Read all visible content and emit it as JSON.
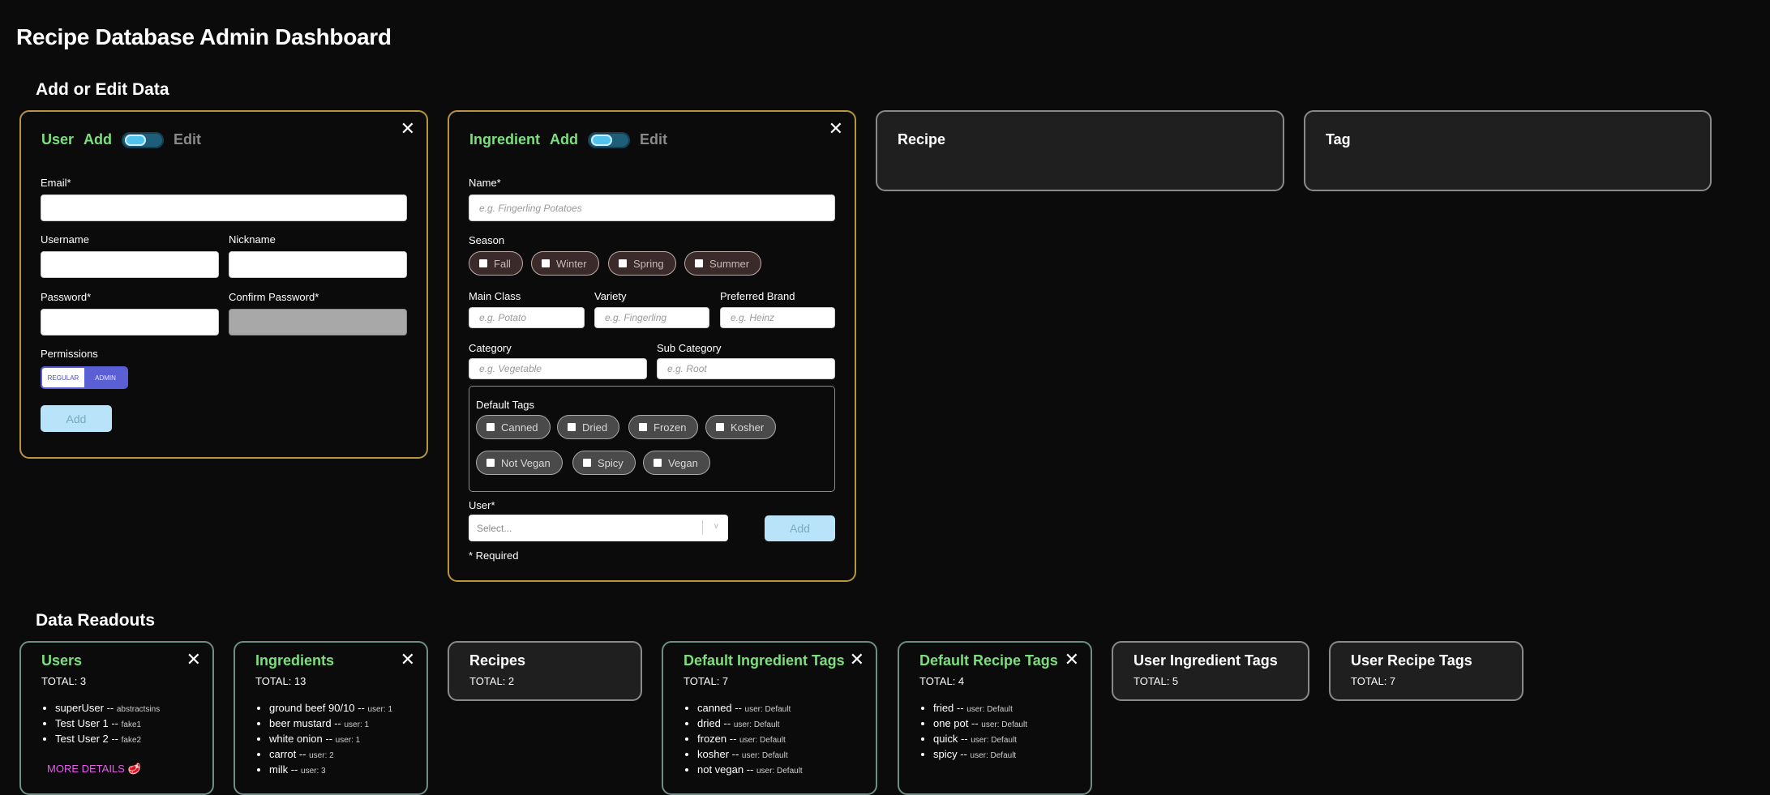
{
  "page": {
    "title": "Recipe Database Admin Dashboard"
  },
  "sections": {
    "edit": "Add or Edit Data",
    "readouts": "Data Readouts"
  },
  "colors": {
    "accent_green": "#7be07b",
    "gold_border": "#b8953a",
    "add_button": "#b9e3f9",
    "permission_toggle": "#5b5fd6"
  },
  "user_form": {
    "title": "User",
    "mode_add": "Add",
    "mode_edit": "Edit",
    "close": "✕",
    "email_label": "Email*",
    "username_label": "Username",
    "nickname_label": "Nickname",
    "password_label": "Password*",
    "confirm_password_label": "Confirm Password*",
    "permissions_label": "Permissions",
    "perm_regular": "REGULAR",
    "perm_admin": "ADMIN",
    "add_button": "Add"
  },
  "ingredient_form": {
    "title": "Ingredient",
    "mode_add": "Add",
    "mode_edit": "Edit",
    "close": "✕",
    "name_label": "Name*",
    "name_placeholder": "e.g. Fingerling Potatoes",
    "season_label": "Season",
    "seasons": [
      "Fall",
      "Winter",
      "Spring",
      "Summer"
    ],
    "main_class_label": "Main Class",
    "main_class_placeholder": "e.g. Potato",
    "variety_label": "Variety",
    "variety_placeholder": "e.g. Fingerling",
    "brand_label": "Preferred Brand",
    "brand_placeholder": "e.g. Heinz",
    "category_label": "Category",
    "category_placeholder": "e.g. Vegetable",
    "subcategory_label": "Sub Category",
    "subcategory_placeholder": "e.g. Root",
    "default_tags_label": "Default Tags",
    "tags": [
      "Canned",
      "Dried",
      "Frozen",
      "Kosher",
      "Not Vegan",
      "Spicy",
      "Vegan"
    ],
    "user_label": "User*",
    "user_select_placeholder": "Select...",
    "add_button": "Add",
    "required_note": "* Required"
  },
  "recipe_form": {
    "title": "Recipe"
  },
  "tag_form": {
    "title": "Tag"
  },
  "readouts": {
    "users": {
      "title": "Users",
      "total": "TOTAL: 3",
      "close": "✕",
      "items": [
        {
          "name": "superUser --",
          "meta": "abstractsins"
        },
        {
          "name": "Test User 1 --",
          "meta": "fake1"
        },
        {
          "name": "Test User 2 --",
          "meta": "fake2"
        }
      ],
      "more": "MORE DETAILS 🥩"
    },
    "ingredients": {
      "title": "Ingredients",
      "total": "TOTAL: 13",
      "close": "✕",
      "items": [
        {
          "name": "ground beef 90/10 --",
          "meta": "user: 1"
        },
        {
          "name": "beer mustard --",
          "meta": "user: 1"
        },
        {
          "name": "white onion --",
          "meta": "user: 1"
        },
        {
          "name": "carrot --",
          "meta": "user: 2"
        },
        {
          "name": "milk --",
          "meta": "user: 3"
        }
      ]
    },
    "recipes": {
      "title": "Recipes",
      "total": "TOTAL: 2"
    },
    "default_ingredient_tags": {
      "title": "Default Ingredient Tags",
      "total": "TOTAL: 7",
      "close": "✕",
      "items": [
        {
          "name": "canned --",
          "meta": "user: Default"
        },
        {
          "name": "dried --",
          "meta": "user: Default"
        },
        {
          "name": "frozen --",
          "meta": "user: Default"
        },
        {
          "name": "kosher --",
          "meta": "user: Default"
        },
        {
          "name": "not vegan --",
          "meta": "user: Default"
        }
      ]
    },
    "default_recipe_tags": {
      "title": "Default Recipe Tags",
      "total": "TOTAL: 4",
      "close": "✕",
      "items": [
        {
          "name": "fried --",
          "meta": "user: Default"
        },
        {
          "name": "one pot --",
          "meta": "user: Default"
        },
        {
          "name": "quick --",
          "meta": "user: Default"
        },
        {
          "name": "spicy --",
          "meta": "user: Default"
        }
      ]
    },
    "user_ingredient_tags": {
      "title": "User Ingredient Tags",
      "total": "TOTAL: 5"
    },
    "user_recipe_tags": {
      "title": "User Recipe Tags",
      "total": "TOTAL: 7"
    }
  }
}
